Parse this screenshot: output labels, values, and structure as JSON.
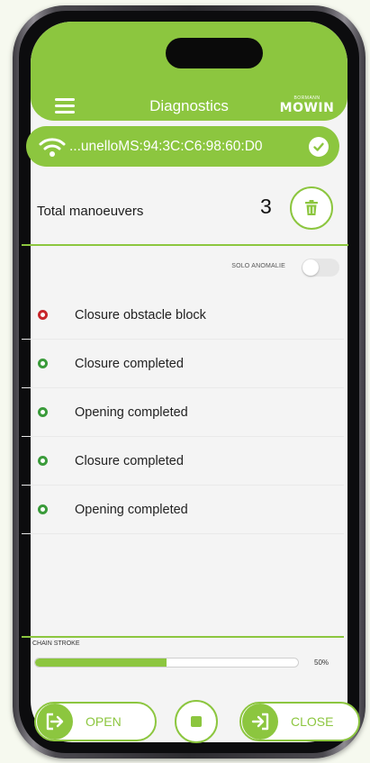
{
  "header": {
    "title": "Diagnostics",
    "logo_small": "BORMANN",
    "logo_main": "MOWIN"
  },
  "connection": {
    "device": "...unelloMS:94:3C:C6:98:60:D0",
    "connected": true
  },
  "summary": {
    "label": "Total manoeuvers",
    "count": "3"
  },
  "filter": {
    "label": "SOLO ANOMALIE",
    "enabled": false
  },
  "events": [
    {
      "text": "Closure obstacle block",
      "status": "error"
    },
    {
      "text": "Closure completed",
      "status": "ok"
    },
    {
      "text": "Opening completed",
      "status": "ok"
    },
    {
      "text": "Closure completed",
      "status": "ok"
    },
    {
      "text": "Opening completed",
      "status": "ok"
    }
  ],
  "chain_stroke": {
    "label": "CHAIN STROKE",
    "percent_text": "50%",
    "fraction": 0.5
  },
  "actions": {
    "open_label": "OPEN",
    "close_label": "CLOSE"
  },
  "icons": {
    "menu": "menu-icon",
    "wifi": "wifi-icon",
    "check": "check-icon",
    "trash": "trash-icon",
    "open": "exit-arrow-icon",
    "stop": "stop-icon",
    "close": "enter-arrow-icon"
  },
  "colors": {
    "accent": "#8cc63f",
    "error": "#c8262b",
    "ok": "#3a9b3a"
  }
}
